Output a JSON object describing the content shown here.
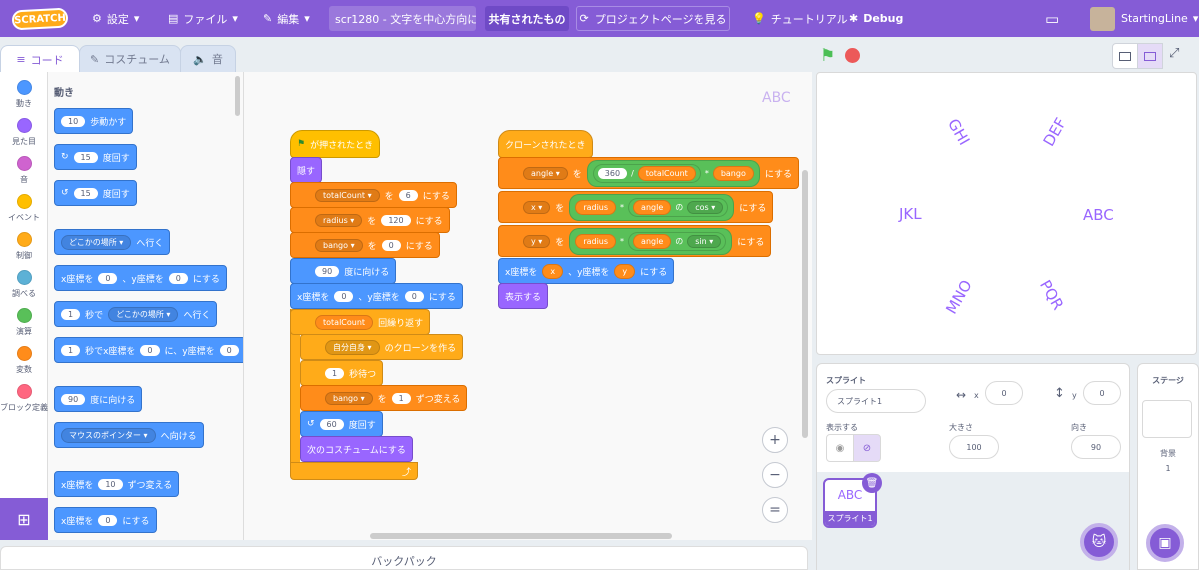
{
  "menubar": {
    "logo": "SCRATCH",
    "settings": "設定",
    "file": "ファイル",
    "edit": "編集",
    "project_title": "scr1280 - 文字を中心方向に…",
    "shared": "共有されたもの",
    "see_project": "プロジェクトページを見る",
    "tutorial": "チュートリアル",
    "debug": "Debug",
    "username": "StartingLine"
  },
  "tabs": {
    "code": "コード",
    "costume": "コスチューム",
    "sound": "音"
  },
  "categories": [
    {
      "label": "動き",
      "color": "#4c97ff"
    },
    {
      "label": "見た目",
      "color": "#9966ff"
    },
    {
      "label": "音",
      "color": "#cf63cf"
    },
    {
      "label": "イベント",
      "color": "#ffbf00"
    },
    {
      "label": "制御",
      "color": "#ffab19"
    },
    {
      "label": "調べる",
      "color": "#5cb1d6"
    },
    {
      "label": "演算",
      "color": "#59c059"
    },
    {
      "label": "変数",
      "color": "#ff8c1a"
    },
    {
      "label": "ブロック定義",
      "color": "#ff6680"
    }
  ],
  "palette": {
    "heading": "動き",
    "move_val": "10",
    "move_text": "歩動かす",
    "turn_r_val": "15",
    "turn_r_text": "度回す",
    "turn_l_val": "15",
    "turn_l_text": "度回す",
    "goto_drop": "どこかの場所",
    "goto_text": "へ行く",
    "gotoxy_a": "x座標を",
    "gotoxy_x": "0",
    "gotoxy_b": "、y座標を",
    "gotoxy_y": "0",
    "gotoxy_c": "にする",
    "glide_val": "1",
    "glide_a": "秒で",
    "glide_drop": "どこかの場所",
    "glide_b": "へ行く",
    "glidexy_val": "1",
    "glidexy_a": "秒でx座標を",
    "glidexy_x": "0",
    "glidexy_b": "に、y座標を",
    "glidexy_y": "0",
    "point_val": "90",
    "point_text": "度に向ける",
    "pointto_drop": "マウスのポインター",
    "pointto_text": "へ向ける",
    "changex_a": "x座標を",
    "changex_val": "10",
    "changex_b": "ずつ変える",
    "setx_a": "x座標を",
    "setx_val": "0",
    "setx_b": "にする"
  },
  "script1": {
    "hat": "が押されたとき",
    "hide": "隠す",
    "set1_var": "totalCount",
    "set1_to": "を",
    "set1_val": "6",
    "set1_end": "にする",
    "set2_var": "radius",
    "set2_to": "を",
    "set2_val": "120",
    "set2_end": "にする",
    "set3_var": "bango",
    "set3_to": "を",
    "set3_val": "0",
    "set3_end": "にする",
    "point_val": "90",
    "point_text": "度に向ける",
    "gotoxy_a": "x座標を",
    "gotoxy_x": "0",
    "gotoxy_b": "、y座標を",
    "gotoxy_y": "0",
    "gotoxy_c": "にする",
    "repeat_var": "totalCount",
    "repeat_text": "回繰り返す",
    "clone_drop": "自分自身",
    "clone_text": "のクローンを作る",
    "wait_val": "1",
    "wait_text": "秒待つ",
    "change_var": "bango",
    "change_to": "を",
    "change_val": "1",
    "change_text": "ずつ変える",
    "turn_val": "60",
    "turn_text": "度回す",
    "next_costume": "次のコスチュームにする"
  },
  "script2": {
    "hat": "クローンされたとき",
    "set_angle_var": "angle",
    "set_angle_to": "を",
    "set_angle_n": "360",
    "set_angle_div": "/",
    "set_angle_tc": "totalCount",
    "set_angle_mul": "*",
    "set_angle_bango": "bango",
    "set_angle_end": "にする",
    "set_x_var": "x",
    "set_x_to": "を",
    "set_x_radius": "radius",
    "set_x_mul": "*",
    "set_x_angle": "angle",
    "set_x_no": "の",
    "set_x_fn": "cos",
    "set_x_end": "にする",
    "set_y_var": "y",
    "set_y_to": "を",
    "set_y_radius": "radius",
    "set_y_mul": "*",
    "set_y_angle": "angle",
    "set_y_no": "の",
    "set_y_fn": "sin",
    "set_y_end": "にする",
    "gotoxy_a": "x座標を",
    "gotoxy_x": "x",
    "gotoxy_b": "、y座標を",
    "gotoxy_y": "y",
    "gotoxy_c": "にする",
    "show": "表示する"
  },
  "workspace": {
    "sprite_label": "ABC",
    "zoom_in": "+",
    "zoom_out": "−",
    "zoom_reset": "="
  },
  "backpack": "バックパック",
  "stage": {
    "texts": [
      "GHI",
      "DEF",
      "JKL",
      "ABC",
      "MNO",
      "PQR"
    ]
  },
  "sprite_info": {
    "sprite_label": "スプライト",
    "name": "スプライト1",
    "x_label": "x",
    "x": "0",
    "y_label": "y",
    "y": "0",
    "show_label": "表示する",
    "size_label": "大きさ",
    "size": "100",
    "direction_label": "向き",
    "direction": "90",
    "thumb_text": "ABC",
    "thumb_name": "スプライト1"
  },
  "stage_pane": {
    "title": "ステージ",
    "backdrop_label": "背景",
    "backdrop_count": "1"
  }
}
